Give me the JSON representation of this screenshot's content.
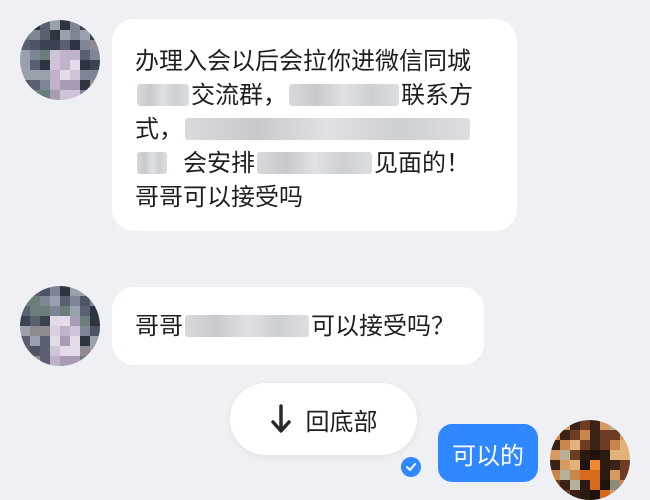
{
  "messages": [
    {
      "sender": "other",
      "lines": [
        {
          "parts": [
            {
              "text": "办理入会以后会拉你进微信同城"
            }
          ]
        },
        {
          "parts": [
            {
              "blur": true
            },
            {
              "text": "交流群，"
            },
            {
              "blur": true
            },
            {
              "text": "联系方"
            }
          ]
        },
        {
          "parts": [
            {
              "text": "式，"
            },
            {
              "blur": true
            }
          ]
        },
        {
          "parts": [
            {
              "blur": true
            },
            {
              "text": "会安排"
            },
            {
              "blur": true
            },
            {
              "text": "见面的！"
            }
          ]
        },
        {
          "parts": [
            {
              "text": "哥哥可以接受吗"
            }
          ]
        }
      ]
    },
    {
      "sender": "other",
      "lines": [
        {
          "parts": [
            {
              "text": "哥哥"
            },
            {
              "blur": true
            },
            {
              "text": "可以接受吗？"
            }
          ]
        }
      ]
    }
  ],
  "to_bottom": {
    "label": "回底部",
    "icon": "arrow-down-icon"
  },
  "reply": {
    "text": "可以的",
    "status_icon": "check-icon"
  },
  "colors": {
    "background": "#eef0f4",
    "bubble_other": "#ffffff",
    "bubble_self": "#2f88ff"
  }
}
